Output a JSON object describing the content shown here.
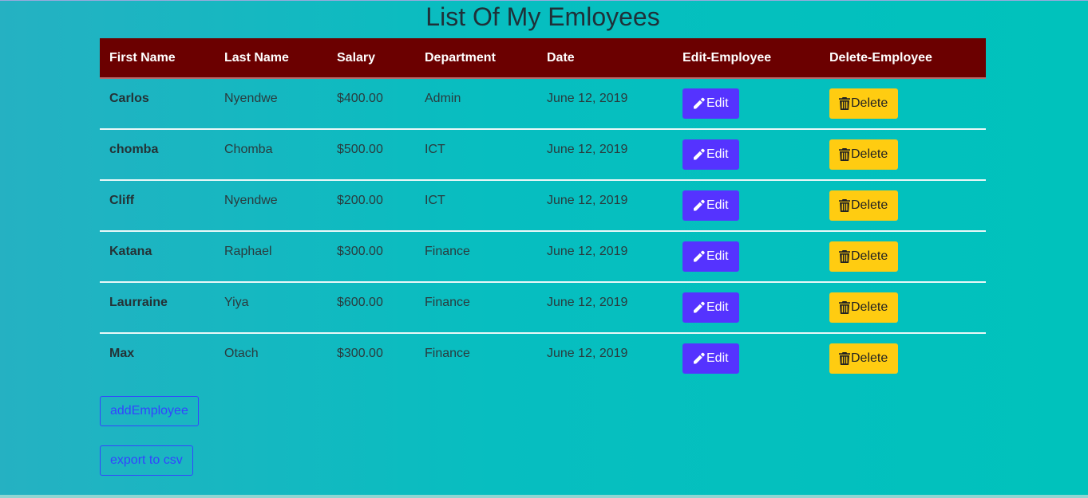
{
  "page": {
    "title": "List Of My Emloyees"
  },
  "table": {
    "headers": [
      "First Name",
      "Last Name",
      "Salary",
      "Department",
      "Date",
      "Edit-Employee",
      "Delete-Employee"
    ],
    "rows": [
      {
        "first": "Carlos",
        "last": "Nyendwe",
        "salary": "$400.00",
        "department": "Admin",
        "date": "June 12, 2019"
      },
      {
        "first": "chomba",
        "last": "Chomba",
        "salary": "$500.00",
        "department": "ICT",
        "date": "June 12, 2019"
      },
      {
        "first": "Cliff",
        "last": "Nyendwe",
        "salary": "$200.00",
        "department": "ICT",
        "date": "June 12, 2019"
      },
      {
        "first": "Katana",
        "last": "Raphael",
        "salary": "$300.00",
        "department": "Finance",
        "date": "June 12, 2019"
      },
      {
        "first": "Laurraine",
        "last": "Yiya",
        "salary": "$600.00",
        "department": "Finance",
        "date": "June 12, 2019"
      },
      {
        "first": "Max",
        "last": "Otach",
        "salary": "$300.00",
        "department": "Finance",
        "date": "June 12, 2019"
      }
    ],
    "edit_label": "Edit",
    "delete_label": "Delete",
    "edit_icon": "pencil-icon",
    "delete_icon": "trash-icon"
  },
  "actions": {
    "add_label": "addEmployee",
    "export_label": "export to csv"
  },
  "colors": {
    "header_bg": "#6b0000",
    "edit_bg": "#5533ff",
    "delete_bg": "#ffcc11",
    "outline": "#3344ff"
  }
}
